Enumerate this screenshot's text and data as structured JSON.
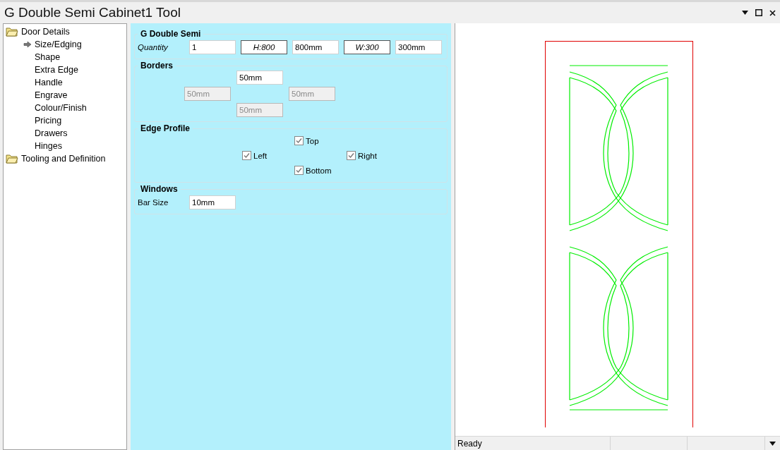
{
  "window": {
    "title": "G Double Semi Cabinet1 Tool"
  },
  "tree": [
    {
      "label": "Door Details",
      "kind": "folder",
      "children": [
        {
          "label": "Size/Edging",
          "selected": true
        },
        {
          "label": "Shape",
          "selected": false
        },
        {
          "label": "Extra Edge",
          "selected": false
        },
        {
          "label": "Handle",
          "selected": false
        },
        {
          "label": "Engrave",
          "selected": false
        },
        {
          "label": "Colour/Finish",
          "selected": false
        },
        {
          "label": "Pricing",
          "selected": false
        },
        {
          "label": "Drawers",
          "selected": false
        },
        {
          "label": "Hinges",
          "selected": false
        }
      ]
    },
    {
      "label": "Tooling and Definition",
      "kind": "folder"
    }
  ],
  "general": {
    "title": "G Double Semi",
    "quantity_label": "Quantity",
    "quantity": "1",
    "height_label": "H:800",
    "height": "800mm",
    "width_label": "W:300",
    "width": "300mm"
  },
  "borders": {
    "title": "Borders",
    "top": {
      "value": "50mm",
      "disabled": false
    },
    "left": {
      "value": "50mm",
      "disabled": true
    },
    "right": {
      "value": "50mm",
      "disabled": true
    },
    "bottom": {
      "value": "50mm",
      "disabled": true
    }
  },
  "edge_profile": {
    "title": "Edge Profile",
    "top": {
      "label": "Top",
      "checked": true
    },
    "left": {
      "label": "Left",
      "checked": true
    },
    "right": {
      "label": "Right",
      "checked": true
    },
    "bottom": {
      "label": "Bottom",
      "checked": true
    }
  },
  "windows": {
    "title": "Windows",
    "bar_size_label": "Bar Size",
    "bar_size": "10mm"
  },
  "status_bar": {
    "text": "Ready"
  }
}
